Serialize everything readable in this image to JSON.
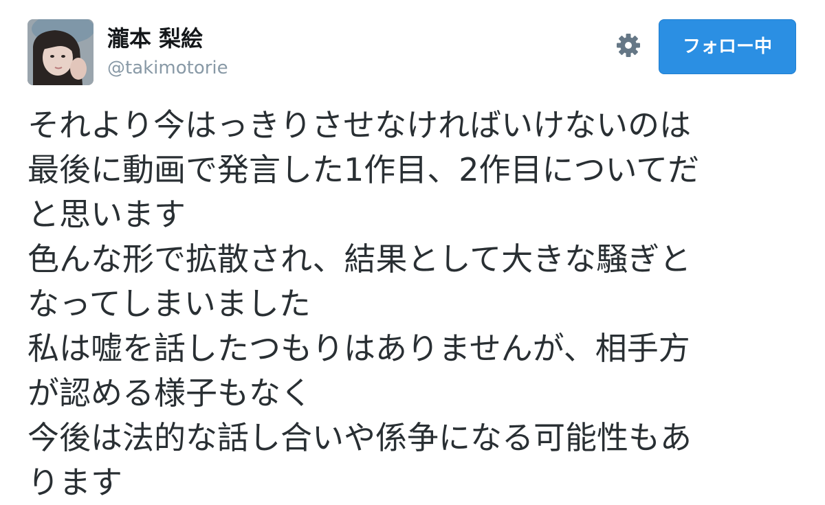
{
  "user": {
    "display_name": "瀧本 梨絵",
    "screen_name": "@takimotorie",
    "avatar_icon": "avatar-photo"
  },
  "actions": {
    "settings_icon": "gear-icon",
    "follow_label": "フォロー中"
  },
  "colors": {
    "accent": "#2b8fe3",
    "text": "#292f33",
    "muted": "#8899a6",
    "icon": "#657786"
  },
  "tweet": {
    "lines": [
      "それより今はっきりさせなければいけないのは",
      "最後に動画で発言した1作目、2作目についてだ",
      "と思います",
      "色んな形で拡散され、結果として大きな騒ぎと",
      "なってしまいました",
      "私は嘘を話したつもりはありませんが、相手方",
      "が認める様子もなく",
      "今後は法的な話し合いや係争になる可能性もあ",
      "ります"
    ]
  }
}
